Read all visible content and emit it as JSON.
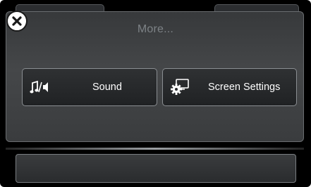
{
  "menu": {
    "title": "More...",
    "close_icon": "close-icon",
    "items": [
      {
        "label": "Sound",
        "icon": "sound-icon"
      },
      {
        "label": "Screen Settings",
        "icon": "screen-settings-icon"
      }
    ]
  },
  "colors": {
    "background": "#000000",
    "panel": "#414345",
    "title_text": "#7d8286",
    "button_text": "#ffffff",
    "button_border": "#8a8e92"
  }
}
